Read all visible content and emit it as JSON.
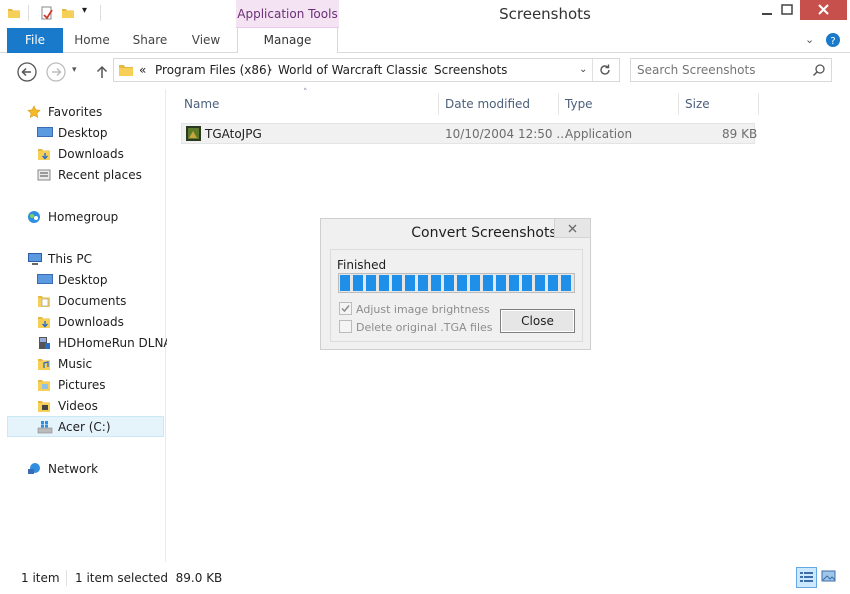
{
  "window": {
    "title": "Screenshots",
    "context_tab_group": "Application Tools"
  },
  "ribbon": {
    "tabs": [
      {
        "label": "File"
      },
      {
        "label": "Home"
      },
      {
        "label": "Share"
      },
      {
        "label": "View"
      },
      {
        "label": "Manage"
      }
    ]
  },
  "address": {
    "overflow": "«",
    "breadcrumbs": [
      "Program Files (x86)",
      "World of Warcraft Classic",
      "Screenshots"
    ],
    "separator": "›"
  },
  "search": {
    "placeholder": "Search Screenshots"
  },
  "nav": {
    "favorites": {
      "label": "Favorites",
      "items": [
        "Desktop",
        "Downloads",
        "Recent places"
      ]
    },
    "homegroup": {
      "label": "Homegroup"
    },
    "this_pc": {
      "label": "This PC",
      "items": [
        "Desktop",
        "Documents",
        "Downloads",
        "HDHomeRun DLNA",
        "Music",
        "Pictures",
        "Videos",
        "Acer (C:)"
      ]
    },
    "network": {
      "label": "Network"
    }
  },
  "file_list": {
    "columns": [
      "Name",
      "Date modified",
      "Type",
      "Size"
    ],
    "rows": [
      {
        "name": "TGAtoJPG",
        "date": "10/10/2004 12:50 ...",
        "type": "Application",
        "size": "89 KB"
      }
    ]
  },
  "dialog": {
    "title": "Convert Screenshots",
    "status": "Finished",
    "progress_percent": 100,
    "option_brightness": "Adjust image brightness",
    "option_brightness_checked": true,
    "option_delete": "Delete original .TGA files",
    "option_delete_checked": false,
    "close_label": "Close"
  },
  "statusbar": {
    "item_count": "1 item",
    "selection": "1 item selected  89.0 KB"
  }
}
